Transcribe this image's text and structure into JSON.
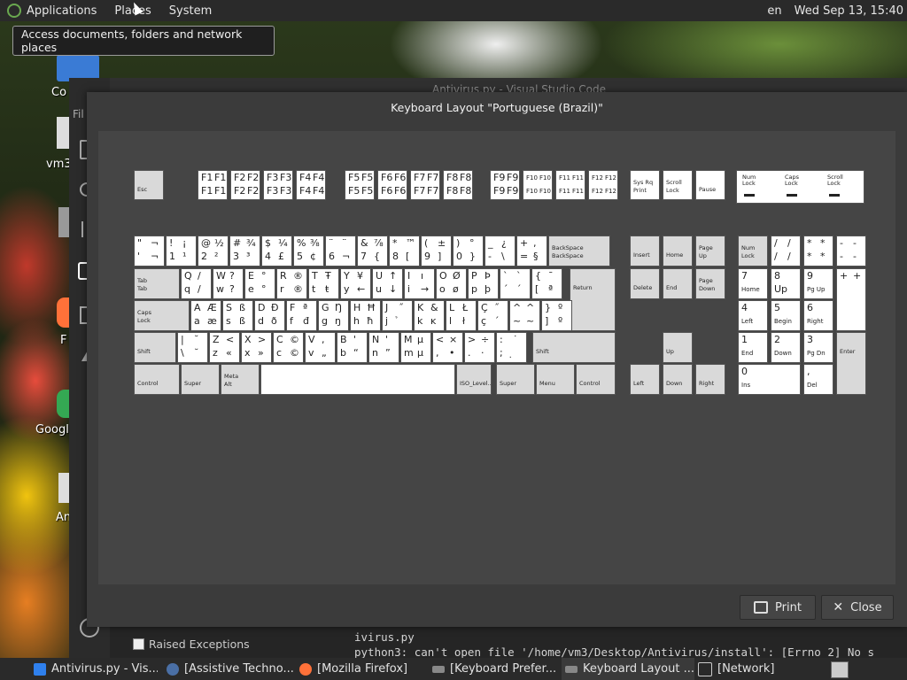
{
  "top_panel": {
    "menus": [
      "Applications",
      "Places",
      "System"
    ],
    "lang": "en",
    "clock": "Wed Sep 13, 15:40"
  },
  "tooltip": "Access documents, folders and network places",
  "desktop_icons": [
    "Co",
    "vm3",
    "F",
    "Googl",
    "An"
  ],
  "background_window": {
    "title": "Antivirus.py - Visual Studio Code",
    "side_label": "Fil",
    "raised_exceptions": "Raised Exceptions",
    "terminal_lines": [
      "ivirus.py",
      "python3: can't open file '/home/vm3/Desktop/Antivirus/install': [Errno 2] No s"
    ]
  },
  "dialog": {
    "title": "Keyboard Layout \"Portuguese (Brazil)\"",
    "print_label": "Print",
    "close_label": "Close"
  },
  "keyboard": {
    "function_row": [
      {
        "label": "Esc"
      },
      {
        "tl": "F1",
        "tr": "F1",
        "bl": "F1",
        "br": "F1"
      },
      {
        "tl": "F2",
        "tr": "F2",
        "bl": "F2",
        "br": "F2"
      },
      {
        "tl": "F3",
        "tr": "F3",
        "bl": "F3",
        "br": "F3"
      },
      {
        "tl": "F4",
        "tr": "F4",
        "bl": "F4",
        "br": "F4"
      },
      {
        "tl": "F5",
        "tr": "F5",
        "bl": "F5",
        "br": "F5"
      },
      {
        "tl": "F6",
        "tr": "F6",
        "bl": "F6",
        "br": "F6"
      },
      {
        "tl": "F7",
        "tr": "F7",
        "bl": "F7",
        "br": "F7"
      },
      {
        "tl": "F8",
        "tr": "F8",
        "bl": "F8",
        "br": "F8"
      },
      {
        "tl": "F9",
        "tr": "F9",
        "bl": "F9",
        "br": "F9"
      },
      {
        "tl": "F10",
        "tr": "F10",
        "bl": "F10",
        "br": "F10"
      },
      {
        "tl": "F11",
        "tr": "F11",
        "bl": "F11",
        "br": "F11"
      },
      {
        "tl": "F12",
        "tr": "F12",
        "bl": "F12",
        "br": "F12"
      },
      {
        "label": "Sys Rq\nPrint"
      },
      {
        "label": "Scroll\nLock"
      },
      {
        "label": "Pause"
      }
    ],
    "locks": [
      "Num Lock",
      "Caps Lock",
      "Scroll Lock"
    ],
    "number_row": [
      {
        "tl": "\"",
        "tr": "¬",
        "bl": "'",
        "br": "¬"
      },
      {
        "tl": "!",
        "tr": "¡",
        "bl": "1",
        "br": "¹"
      },
      {
        "tl": "@",
        "tr": "½",
        "bl": "2",
        "br": "²"
      },
      {
        "tl": "#",
        "tr": "¾",
        "bl": "3",
        "br": "³"
      },
      {
        "tl": "$",
        "tr": "¼",
        "bl": "4",
        "br": "£"
      },
      {
        "tl": "%",
        "tr": "⅜",
        "bl": "5",
        "br": "¢"
      },
      {
        "tl": "¨",
        "tr": "¨",
        "bl": "6",
        "br": "¬"
      },
      {
        "tl": "&",
        "tr": "⅞",
        "bl": "7",
        "br": "{"
      },
      {
        "tl": "*",
        "tr": "™",
        "bl": "8",
        "br": "["
      },
      {
        "tl": "(",
        "tr": "±",
        "bl": "9",
        "br": "]"
      },
      {
        "tl": ")",
        "tr": "°",
        "bl": "0",
        "br": "}"
      },
      {
        "tl": "_",
        "tr": "¿",
        "bl": "-",
        "br": "\\"
      },
      {
        "tl": "+",
        "tr": ",",
        "bl": "=",
        "br": "§"
      },
      {
        "label": "BackSpace\nBackSpace"
      }
    ],
    "q_row": [
      {
        "label": "Tab\nTab"
      },
      {
        "tl": "Q",
        "tr": "/",
        "bl": "q",
        "br": "/"
      },
      {
        "tl": "W",
        "tr": "?",
        "bl": "w",
        "br": "?"
      },
      {
        "tl": "E",
        "tr": "°",
        "bl": "e",
        "br": "°"
      },
      {
        "tl": "R",
        "tr": "®",
        "bl": "r",
        "br": "®"
      },
      {
        "tl": "T",
        "tr": "Ŧ",
        "bl": "t",
        "br": "ŧ"
      },
      {
        "tl": "Y",
        "tr": "¥",
        "bl": "y",
        "br": "←"
      },
      {
        "tl": "U",
        "tr": "↑",
        "bl": "u",
        "br": "↓"
      },
      {
        "tl": "I",
        "tr": "ı",
        "bl": "i",
        "br": "→"
      },
      {
        "tl": "O",
        "tr": "Ø",
        "bl": "o",
        "br": "ø"
      },
      {
        "tl": "P",
        "tr": "Þ",
        "bl": "p",
        "br": "þ"
      },
      {
        "tl": "`",
        "tr": "`",
        "bl": "´",
        "br": "´"
      },
      {
        "tl": "{",
        "tr": "¯",
        "bl": "[",
        "br": "ª"
      },
      {
        "label": "Return"
      }
    ],
    "a_row": [
      {
        "label": "Caps\nLock"
      },
      {
        "tl": "A",
        "tr": "Æ",
        "bl": "a",
        "br": "æ"
      },
      {
        "tl": "S",
        "tr": "ß",
        "bl": "s",
        "br": "ß"
      },
      {
        "tl": "D",
        "tr": "Đ",
        "bl": "d",
        "br": "ð"
      },
      {
        "tl": "F",
        "tr": "ª",
        "bl": "f",
        "br": "đ"
      },
      {
        "tl": "G",
        "tr": "Ŋ",
        "bl": "g",
        "br": "ŋ"
      },
      {
        "tl": "H",
        "tr": "Ħ",
        "bl": "h",
        "br": "ħ"
      },
      {
        "tl": "J",
        "tr": "˝",
        "bl": "j",
        "br": "̉"
      },
      {
        "tl": "K",
        "tr": "&",
        "bl": "k",
        "br": "ĸ"
      },
      {
        "tl": "L",
        "tr": "Ł",
        "bl": "l",
        "br": "ł"
      },
      {
        "tl": "Ç",
        "tr": "˝",
        "bl": "ç",
        "br": "´"
      },
      {
        "tl": "^",
        "tr": "^",
        "bl": "~",
        "br": "~"
      },
      {
        "tl": "}",
        "tr": "º",
        "bl": "]",
        "br": "º"
      }
    ],
    "z_row": [
      {
        "label": "Shift"
      },
      {
        "tl": "|",
        "tr": "˘",
        "bl": "\\",
        "br": "˘"
      },
      {
        "tl": "Z",
        "tr": "<",
        "bl": "z",
        "br": "«"
      },
      {
        "tl": "X",
        "tr": ">",
        "bl": "x",
        "br": "»"
      },
      {
        "tl": "C",
        "tr": "©",
        "bl": "c",
        "br": "©"
      },
      {
        "tl": "V",
        "tr": ",",
        "bl": "v",
        "br": "„"
      },
      {
        "tl": "B",
        "tr": "'",
        "bl": "b",
        "br": "“"
      },
      {
        "tl": "N",
        "tr": "'",
        "bl": "n",
        "br": "”"
      },
      {
        "tl": "M",
        "tr": "µ",
        "bl": "m",
        "br": "µ"
      },
      {
        "tl": "<",
        "tr": "×",
        "bl": ",",
        "br": "•"
      },
      {
        "tl": ">",
        "tr": "÷",
        "bl": ".",
        "br": "·"
      },
      {
        "tl": ":",
        "tr": "˙",
        "bl": ";",
        "br": "̣"
      },
      {
        "label": "Shift"
      }
    ],
    "bottom_row": [
      {
        "label": "Control"
      },
      {
        "label": "Super"
      },
      {
        "label": "Meta\nAlt"
      },
      {
        "label": ""
      },
      {
        "label": "ISO_Level..."
      },
      {
        "label": "Super"
      },
      {
        "label": "Menu"
      },
      {
        "label": "Control"
      }
    ],
    "nav_keys": [
      "Insert",
      "Home",
      "Page\nUp",
      "Delete",
      "End",
      "Page\nDown"
    ],
    "arrow_keys": [
      "Up",
      "Left",
      "Down",
      "Right"
    ],
    "numpad": [
      {
        "label": "Num\nLock"
      },
      {
        "tl": "/",
        "tr": "/",
        "bl": "/",
        "br": "/"
      },
      {
        "tl": "*",
        "tr": "*",
        "bl": "*",
        "br": "*"
      },
      {
        "tl": "-",
        "tr": "-",
        "bl": "-",
        "br": "-"
      },
      {
        "tl": "7",
        "bl": "Home"
      },
      {
        "tl": "8",
        "bl": "Up"
      },
      {
        "tl": "9",
        "bl": "Pg Up"
      },
      {
        "tl": "+",
        "tr": "+"
      },
      {
        "tl": "4",
        "bl": "Left"
      },
      {
        "tl": "5",
        "bl": "Begin"
      },
      {
        "tl": "6",
        "bl": "Right"
      },
      {
        "tl": "+",
        "tr": "+"
      },
      {
        "tl": "1",
        "bl": "End"
      },
      {
        "tl": "2",
        "bl": "Down"
      },
      {
        "tl": "3",
        "bl": "Pg Dn"
      },
      {
        "label": "Enter"
      },
      {
        "tl": "0",
        "bl": "Ins"
      },
      {
        "tl": ",",
        "bl": "Del"
      }
    ]
  },
  "taskbar": [
    "Antivirus.py - Vis...",
    "[Assistive Techno...",
    "[Mozilla Firefox]",
    "[Keyboard Prefer...",
    "Keyboard Layout ...",
    "[Network]"
  ]
}
